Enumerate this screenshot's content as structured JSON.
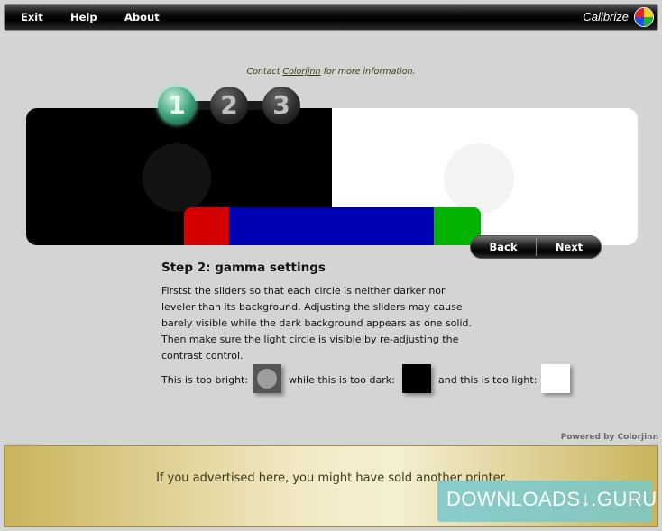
{
  "menu": {
    "exit": "Exit",
    "help": "Help",
    "about": "About",
    "brand": "Calibrize"
  },
  "steps": [
    "1",
    "2",
    "3"
  ],
  "active_step": 1,
  "nav": {
    "back": "Back",
    "next": "Next"
  },
  "content": {
    "heading": "Step 2: gamma settings",
    "lines": [
      "Firstst the sliders so that each circle is neither darker nor",
      "leveler than its background. Adjusting the sliders may cause",
      "barely visible while the dark background appears as one solid.",
      "Then make sure the light circle is visible by re-adjusting the",
      "contrast control."
    ],
    "too_bright": "This is too bright:",
    "too_dark": "while this is too dark:",
    "too_light": "and this is too light:"
  },
  "powered_by": "Powered by Colorjinn",
  "ad": {
    "text": "If you advertised here, you might have sold another printer.",
    "contact_prefix": "Contact",
    "contact_link": "Colorjinn",
    "contact_suffix": "for more information."
  },
  "watermark": "DOWNLOADS↓.GURU",
  "colors": {
    "red": "#d40000",
    "blue": "#0000b4",
    "green": "#00b400",
    "active_step": "#3aa07a"
  },
  "icons": [
    "calibrize-logo-icon"
  ]
}
